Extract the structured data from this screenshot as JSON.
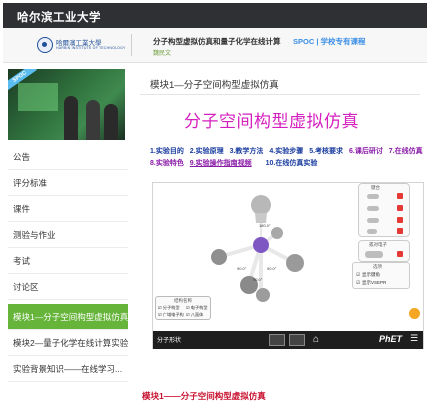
{
  "topbar": {
    "brand": "哈尔滨工业大学"
  },
  "course_header": {
    "logo_text": "哈爾濱工業大學",
    "logo_subtext": "HARBIN INSTITUTE OF TECHNOLOGY",
    "title": "分子构型虚拟仿真和量子化学在线计算",
    "type": "SPOC | 学校专有课程",
    "teacher": "魏民文"
  },
  "cover": {
    "badge": "SPOC"
  },
  "sidebar": {
    "items": [
      {
        "label": "公告"
      },
      {
        "label": "评分标准"
      },
      {
        "label": "课件"
      },
      {
        "label": "测验与作业"
      },
      {
        "label": "考试"
      },
      {
        "label": "讨论区"
      },
      {
        "label": "模块1—分子空间构型虚拟仿真"
      },
      {
        "label": "模块2—量子化学在线计算实验"
      },
      {
        "label": "实验背景知识——在线学习..."
      }
    ],
    "active_index": 6
  },
  "main": {
    "module_title": "模块1—分子空间构型虚拟仿真",
    "big_title": "分子空间构型虚拟仿真",
    "links_row1": [
      "1.实验目的",
      "2.实验原理",
      "3.教学方法",
      "4.实验步骤",
      "5.考核要求",
      "6.课后研讨",
      "7.在线仿真"
    ],
    "links_row2": [
      "8.实验特色",
      "9.实验操作指南视频",
      "10.在线仿真实验"
    ]
  },
  "simulation": {
    "controls_title": "键合",
    "lone_pair_title": "孤对电子",
    "options_title": "选项",
    "options": [
      "显示键角",
      "显示VSEPR"
    ],
    "legend_title": "结构名称",
    "legend_items": [
      "分子构型",
      "电子构型",
      "广域电子构",
      "八面体"
    ],
    "angle_labels": [
      "90.0°",
      "90.0°",
      "90.0°",
      "180.0°"
    ],
    "screen_label": "分子形状",
    "brand": "PhET",
    "colors": {
      "central_atom": "#7e57c2",
      "bonded_atom": "#b0b0b0",
      "bond": "#ffffff",
      "reset_button": "#f5a623",
      "remove_button": "#e53935"
    }
  },
  "footer": {
    "caption": "模块1——分子空间构型虚拟仿真"
  },
  "colors": {
    "topbar": "#2e3033",
    "active_nav": "#66b43a",
    "title_magenta": "#d61fbf",
    "link_blue": "#1a3c9f",
    "link_purple": "#8a1ba8",
    "caption_red": "#c8102e"
  }
}
